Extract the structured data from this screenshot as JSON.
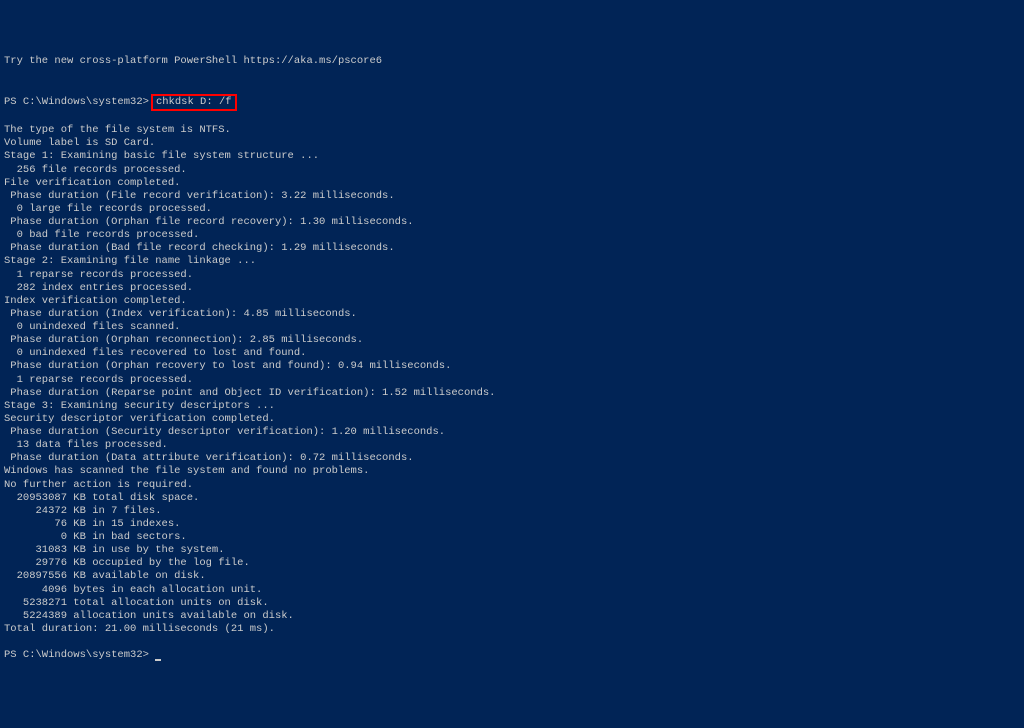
{
  "intro": "Try the new cross-platform PowerShell https://aka.ms/pscore6",
  "blank1": "",
  "prompt1_prefix": "PS C:\\Windows\\system32>",
  "command": "chkdsk D: /f",
  "lines": [
    "The type of the file system is NTFS.",
    "Volume label is SD Card.",
    "",
    "Stage 1: Examining basic file system structure ...",
    "  256 file records processed.",
    "File verification completed.",
    " Phase duration (File record verification): 3.22 milliseconds.",
    "  0 large file records processed.",
    " Phase duration (Orphan file record recovery): 1.30 milliseconds.",
    "  0 bad file records processed.",
    " Phase duration (Bad file record checking): 1.29 milliseconds.",
    "",
    "Stage 2: Examining file name linkage ...",
    "  1 reparse records processed.",
    "  282 index entries processed.",
    "Index verification completed.",
    " Phase duration (Index verification): 4.85 milliseconds.",
    "  0 unindexed files scanned.",
    " Phase duration (Orphan reconnection): 2.85 milliseconds.",
    "  0 unindexed files recovered to lost and found.",
    " Phase duration (Orphan recovery to lost and found): 0.94 milliseconds.",
    "  1 reparse records processed.",
    " Phase duration (Reparse point and Object ID verification): 1.52 milliseconds.",
    "",
    "Stage 3: Examining security descriptors ...",
    "Security descriptor verification completed.",
    " Phase duration (Security descriptor verification): 1.20 milliseconds.",
    "  13 data files processed.",
    " Phase duration (Data attribute verification): 0.72 milliseconds.",
    "",
    "Windows has scanned the file system and found no problems.",
    "No further action is required.",
    "",
    "  20953087 KB total disk space.",
    "     24372 KB in 7 files.",
    "        76 KB in 15 indexes.",
    "         0 KB in bad sectors.",
    "     31083 KB in use by the system.",
    "     29776 KB occupied by the log file.",
    "  20897556 KB available on disk.",
    "",
    "      4096 bytes in each allocation unit.",
    "   5238271 total allocation units on disk.",
    "   5224389 allocation units available on disk.",
    "Total duration: 21.00 milliseconds (21 ms)."
  ],
  "prompt2": "PS C:\\Windows\\system32> "
}
